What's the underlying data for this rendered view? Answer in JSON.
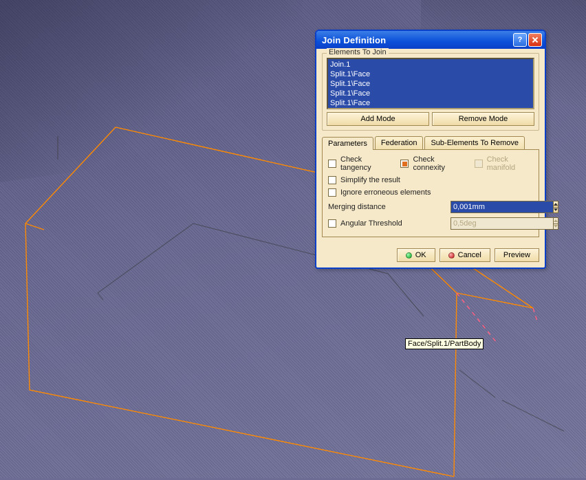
{
  "viewport": {
    "tooltip": "Face/Split.1/PartBody"
  },
  "dialog": {
    "title": "Join Definition",
    "group_label": "Elements To Join",
    "list_items": [
      "Join.1",
      "Split.1\\Face",
      "Split.1\\Face",
      "Split.1\\Face",
      "Split.1\\Face"
    ],
    "add_mode": "Add Mode",
    "remove_mode": "Remove Mode",
    "tabs": {
      "parameters": "Parameters",
      "federation": "Federation",
      "subelements": "Sub-Elements To Remove"
    },
    "checks": {
      "tangency": "Check tangency",
      "connexity": "Check connexity",
      "manifold": "Check manifold",
      "simplify": "Simplify the result",
      "ignore": "Ignore erroneous elements",
      "angular": "Angular Threshold"
    },
    "fields": {
      "merging_label": "Merging distance",
      "merging_value": "0,001mm",
      "angular_value": "0,5deg"
    },
    "buttons": {
      "ok": "OK",
      "cancel": "Cancel",
      "preview": "Preview"
    }
  }
}
